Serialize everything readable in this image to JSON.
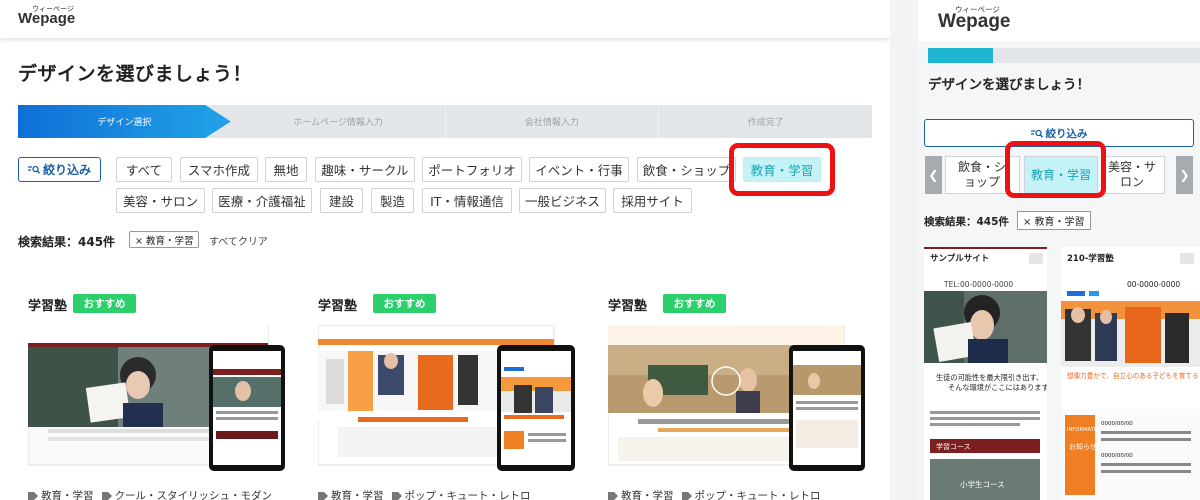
{
  "brand": {
    "logo": "Wepage",
    "logo_kana": "ウィーページ"
  },
  "page": {
    "title": "デザインを選びましょう！"
  },
  "steps": [
    "デザイン選択",
    "ホームページ情報入力",
    "会社情報入力",
    "作成完了"
  ],
  "filter": {
    "label": "絞り込み"
  },
  "categories": [
    "すべて",
    "スマホ作成",
    "無地",
    "趣味・サークル",
    "ポートフォリオ",
    "イベント・行事",
    "飲食・ショップ",
    "教育・学習",
    "美容・サロン",
    "医療・介護福祉",
    "建設",
    "製造",
    "IT・情報通信",
    "一般ビジネス",
    "採用サイト"
  ],
  "selected_category": "教育・学習",
  "results": {
    "label": "検索結果：445件",
    "active_filter": "× 教育・学習",
    "clear_all": "すべてクリア"
  },
  "cards": [
    {
      "title": "学習塾",
      "badge": "おすすめ",
      "tags": [
        "教育・学習",
        "クール・スタイリッシュ・モダン"
      ]
    },
    {
      "title": "学習塾",
      "badge": "おすすめ",
      "tags": [
        "教育・学習",
        "ポップ・キュート・レトロ"
      ]
    },
    {
      "title": "学習塾",
      "badge": "おすすめ",
      "tags": [
        "教育・学習",
        "ポップ・キュート・レトロ"
      ]
    }
  ],
  "mobile": {
    "progress": 0.24,
    "visible_categories": [
      "飲食・ショップ",
      "教育・学習",
      "美容・サロン"
    ],
    "results_label": "検索結果：445件",
    "active_filter": "× 教育・学習",
    "thumb1": {
      "site_name": "サンプルサイト",
      "tel": "TEL:00-0000-0000",
      "headline": "生徒の可能性を最大限引き出す、そんな環境がここにはあります",
      "section": "学習コース",
      "course": "小学生コース"
    },
    "thumb2": {
      "site_name": "210-学習塾",
      "tel": "00-0000-0000",
      "info": "INFORMATION",
      "news": "お知らせ",
      "date1": "0000/00/00",
      "date2": "0000/00/00",
      "banner": "想像力豊かで、自立心のある子どもを育てる"
    }
  },
  "colors": {
    "accent": "#1a5fa8",
    "selected_bg": "#c4f2f7",
    "highlight": "#ee1111",
    "badge": "#2bcf6b",
    "step_active": "#1a8de0"
  }
}
